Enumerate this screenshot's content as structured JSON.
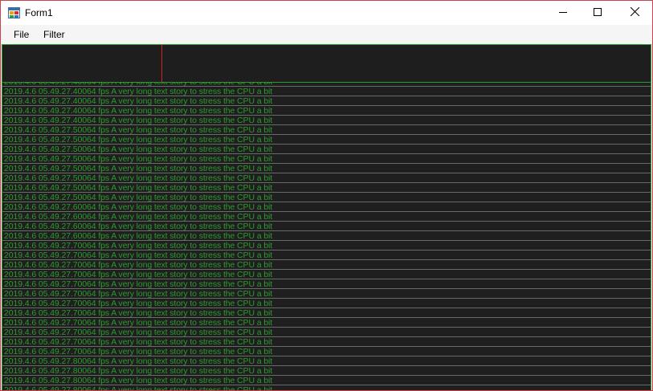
{
  "window": {
    "title": "Form1",
    "icon": "winforms-app-icon"
  },
  "caption_buttons": {
    "minimize": "minimize-icon",
    "maximize": "maximize-icon",
    "close": "close-icon"
  },
  "menu": {
    "file_label": "File",
    "filter_label": "Filter"
  },
  "colors": {
    "log_text": "#2c9b2c",
    "log_background": "#1f1f1f",
    "graph_marker": "#d42020",
    "window_border": "#c9434f"
  },
  "log": {
    "rows": [
      {
        "timestamp": "2019.4.6 05.49.27.4",
        "fps": "0064",
        "message": "fps A very long text story to stress the CPU a bit"
      },
      {
        "timestamp": "2019.4.6 05.49.27.4",
        "fps": "0064",
        "message": "fps A very long text story to stress the CPU a bit"
      },
      {
        "timestamp": "2019.4.6 05.49.27.4",
        "fps": "0064",
        "message": "fps A very long text story to stress the CPU a bit"
      },
      {
        "timestamp": "2019.4.6 05.49.27.4",
        "fps": "0064",
        "message": "fps A very long text story to stress the CPU a bit"
      },
      {
        "timestamp": "2019.4.6 05.49.27.4",
        "fps": "0064",
        "message": "fps A very long text story to stress the CPU a bit"
      },
      {
        "timestamp": "2019.4.6 05.49.27.5",
        "fps": "0064",
        "message": "fps A very long text story to stress the CPU a bit"
      },
      {
        "timestamp": "2019.4.6 05.49.27.5",
        "fps": "0064",
        "message": "fps A very long text story to stress the CPU a bit"
      },
      {
        "timestamp": "2019.4.6 05.49.27.5",
        "fps": "0064",
        "message": "fps A very long text story to stress the CPU a bit"
      },
      {
        "timestamp": "2019.4.6 05.49.27.5",
        "fps": "0064",
        "message": "fps A very long text story to stress the CPU a bit"
      },
      {
        "timestamp": "2019.4.6 05.49.27.5",
        "fps": "0064",
        "message": "fps A very long text story to stress the CPU a bit"
      },
      {
        "timestamp": "2019.4.6 05.49.27.5",
        "fps": "0064",
        "message": "fps A very long text story to stress the CPU a bit"
      },
      {
        "timestamp": "2019.4.6 05.49.27.5",
        "fps": "0064",
        "message": "fps A very long text story to stress the CPU a bit"
      },
      {
        "timestamp": "2019.4.6 05.49.27.5",
        "fps": "0064",
        "message": "fps A very long text story to stress the CPU a bit"
      },
      {
        "timestamp": "2019.4.6 05.49.27.6",
        "fps": "0064",
        "message": "fps A very long text story to stress the CPU a bit"
      },
      {
        "timestamp": "2019.4.6 05.49.27.6",
        "fps": "0064",
        "message": "fps A very long text story to stress the CPU a bit"
      },
      {
        "timestamp": "2019.4.6 05.49.27.6",
        "fps": "0064",
        "message": "fps A very long text story to stress the CPU a bit"
      },
      {
        "timestamp": "2019.4.6 05.49.27.6",
        "fps": "0064",
        "message": "fps A very long text story to stress the CPU a bit"
      },
      {
        "timestamp": "2019.4.6 05.49.27.7",
        "fps": "0064",
        "message": "fps A very long text story to stress the CPU a bit"
      },
      {
        "timestamp": "2019.4.6 05.49.27.7",
        "fps": "0064",
        "message": "fps A very long text story to stress the CPU a bit"
      },
      {
        "timestamp": "2019.4.6 05.49.27.7",
        "fps": "0064",
        "message": "fps A very long text story to stress the CPU a bit"
      },
      {
        "timestamp": "2019.4.6 05.49.27.7",
        "fps": "0064",
        "message": "fps A very long text story to stress the CPU a bit"
      },
      {
        "timestamp": "2019.4.6 05.49.27.7",
        "fps": "0064",
        "message": "fps A very long text story to stress the CPU a bit"
      },
      {
        "timestamp": "2019.4.6 05.49.27.7",
        "fps": "0064",
        "message": "fps A very long text story to stress the CPU a bit"
      },
      {
        "timestamp": "2019.4.6 05.49.27.7",
        "fps": "0064",
        "message": "fps A very long text story to stress the CPU a bit"
      },
      {
        "timestamp": "2019.4.6 05.49.27.7",
        "fps": "0064",
        "message": "fps A very long text story to stress the CPU a bit"
      },
      {
        "timestamp": "2019.4.6 05.49.27.7",
        "fps": "0064",
        "message": "fps A very long text story to stress the CPU a bit"
      },
      {
        "timestamp": "2019.4.6 05.49.27.7",
        "fps": "0064",
        "message": "fps A very long text story to stress the CPU a bit"
      },
      {
        "timestamp": "2019.4.6 05.49.27.7",
        "fps": "0064",
        "message": "fps A very long text story to stress the CPU a bit"
      },
      {
        "timestamp": "2019.4.6 05.49.27.7",
        "fps": "0064",
        "message": "fps A very long text story to stress the CPU a bit"
      },
      {
        "timestamp": "2019.4.6 05.49.27.8",
        "fps": "0064",
        "message": "fps A very long text story to stress the CPU a bit"
      },
      {
        "timestamp": "2019.4.6 05.49.27.8",
        "fps": "0064",
        "message": "fps A very long text story to stress the CPU a bit"
      },
      {
        "timestamp": "2019.4.6 05.49.27.8",
        "fps": "0064",
        "message": "fps A very long text story to stress the CPU a bit"
      },
      {
        "timestamp": "2019.4.6 05.49.27.8",
        "fps": "0064",
        "message": "fps A very long text story to stress the CPU a bit"
      },
      {
        "timestamp": "2019.4.6 05.49.27.8",
        "fps": "0064",
        "message": "fps A very long text story to stress the CPU a bit"
      }
    ]
  }
}
